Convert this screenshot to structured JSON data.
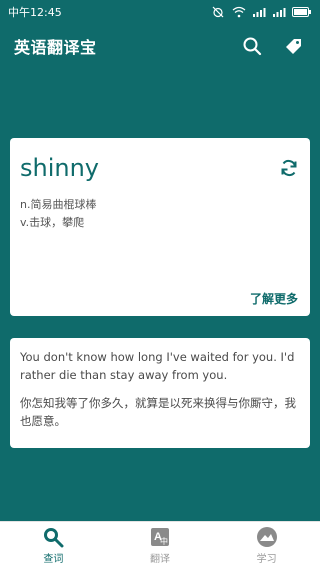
{
  "status_bar": {
    "time": "中午12:45"
  },
  "app_bar": {
    "title": "英语翻译宝",
    "search_icon": "search-icon",
    "tag_icon": "tag-icon"
  },
  "word_card": {
    "word": "shinny",
    "definitions": [
      "n.简易曲棍球棒",
      "v.击球，攀爬"
    ],
    "learn_more": "了解更多",
    "refresh_icon": "refresh-icon"
  },
  "sentence_card": {
    "english": "You don't know how long I've waited for you. I'd rather die than stay away from you.",
    "chinese": "你怎知我等了你多久，就算是以死来换得与你厮守，我也愿意。"
  },
  "bottom_nav": {
    "items": [
      {
        "label": "查词",
        "icon": "search-icon",
        "active": true
      },
      {
        "label": "翻译",
        "icon": "translate-icon",
        "active": false
      },
      {
        "label": "学习",
        "icon": "learn-icon",
        "active": false
      }
    ]
  },
  "colors": {
    "primary": "#0f6b6b",
    "card": "#ffffff",
    "inactive": "#9a9a9a"
  }
}
